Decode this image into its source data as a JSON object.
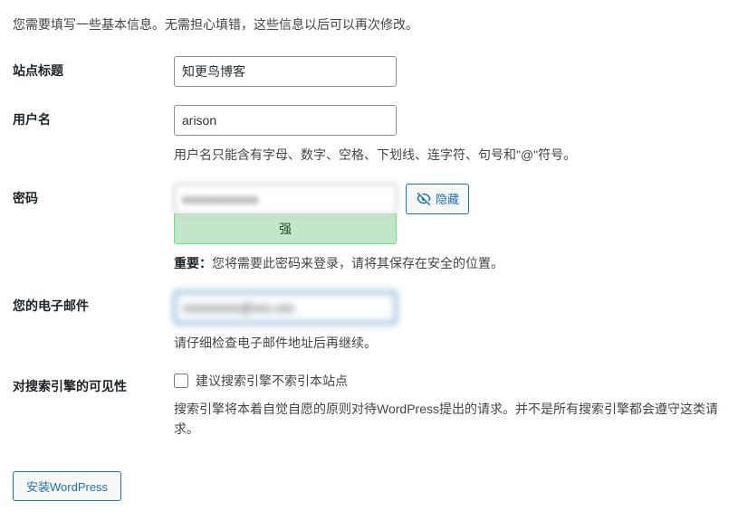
{
  "intro": "您需要填写一些基本信息。无需担心填错，这些信息以后可以再次修改。",
  "fields": {
    "site_title": {
      "label": "站点标题",
      "value": "知更鸟博客"
    },
    "username": {
      "label": "用户名",
      "value": "arison",
      "hint": "用户名只能含有字母、数字、空格、下划线、连字符、句号和\"@\"符号。"
    },
    "password": {
      "label": "密码",
      "value": "xxxxxxxxxxxx",
      "hide_btn": "隐藏",
      "strength": "强",
      "hint_label": "重要：",
      "hint": "您将需要此密码来登录，请将其保存在安全的位置。"
    },
    "email": {
      "label": "您的电子邮件",
      "value": "xxxxxxxxx@xxx.xxx",
      "hint": "请仔细检查电子邮件地址后再继续。"
    },
    "visibility": {
      "label": "对搜索引擎的可见性",
      "checkbox_label": "建议搜索引擎不索引本站点",
      "hint": "搜索引擎将本着自觉自愿的原则对待WordPress提出的请求。并不是所有搜索引擎都会遵守这类请求。"
    }
  },
  "submit": "安装WordPress"
}
